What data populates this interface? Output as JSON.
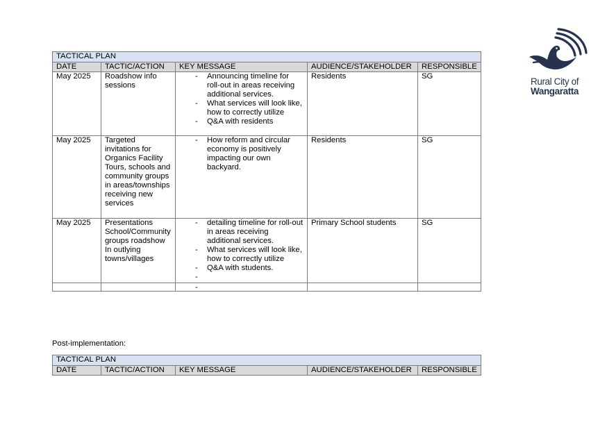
{
  "tactical": {
    "title": "TACTICAL PLAN",
    "headers": [
      "DATE",
      "TACTIC/ACTION",
      "KEY MESSAGE",
      "AUDIENCE/STAKEHOLDER",
      "RESPONSIBLE"
    ],
    "rows": [
      {
        "date": "May 2025",
        "tactic": "Roadshow info sessions",
        "messages": [
          "Announcing timeline for roll-out in areas receiving additional services.",
          "What services will look like, how to correctly utilize",
          "Q&A with residents"
        ],
        "audience": "Residents",
        "responsible": "SG"
      },
      {
        "date": "May 2025",
        "tactic": "Targeted invitations for Organics Facility Tours, schools and community groups in areas/townships receiving new services",
        "messages": [
          "How reform and circular economy is positively impacting our own backyard."
        ],
        "audience": "Residents",
        "responsible": "SG"
      },
      {
        "date": "May 2025",
        "tactic": "Presentations School/Community groups roadshow In outlying towns/villages",
        "messages": [
          "detailing timeline for roll-out in areas receiving additional services.",
          "What services will look like, how to correctly utilize",
          "Q&A with students.",
          ""
        ],
        "audience": "Primary School students",
        "responsible": "SG"
      },
      {
        "date": "",
        "tactic": "",
        "messages": [
          ""
        ],
        "audience": "",
        "responsible": ""
      }
    ]
  },
  "post": {
    "label": "Post-implementation:",
    "title": "TACTICAL PLAN",
    "headers": [
      "DATE",
      "TACTIC/ACTION",
      "KEY MESSAGE",
      "AUDIENCE/STAKEHOLDER",
      "RESPONSIBLE"
    ]
  },
  "logo": {
    "line1": "Rural City of",
    "line2": "Wangaratta",
    "color": "#26324f"
  }
}
